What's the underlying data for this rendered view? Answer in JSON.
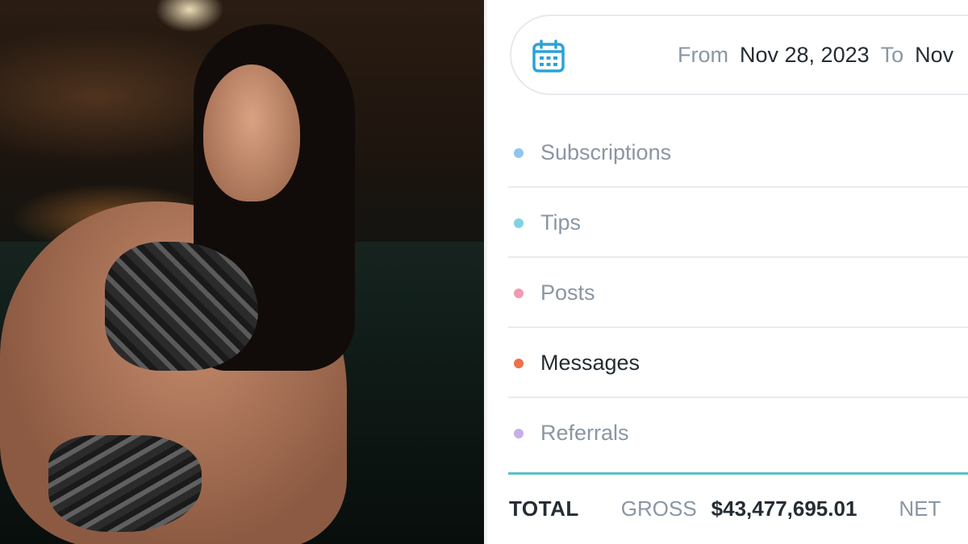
{
  "photo": {
    "description_icon": "photo-image"
  },
  "date_range": {
    "icon": "calendar-icon",
    "from_label": "From",
    "from_value": "Nov 28, 2023",
    "to_label": "To",
    "to_value": "Nov"
  },
  "categories": [
    {
      "label": "Subscriptions",
      "color": "#8ec5ef"
    },
    {
      "label": "Tips",
      "color": "#7fd3e3"
    },
    {
      "label": "Posts",
      "color": "#f29ab2"
    },
    {
      "label": "Messages",
      "color": "#ee7047"
    },
    {
      "label": "Referrals",
      "color": "#c8aee8"
    }
  ],
  "total": {
    "label": "TOTAL",
    "gross_label": "GROSS",
    "gross_value": "$43,477,695.01",
    "net_label": "NET"
  },
  "colors": {
    "accent_line": "#5ac0c9",
    "calendar": "#2aa3d6"
  }
}
